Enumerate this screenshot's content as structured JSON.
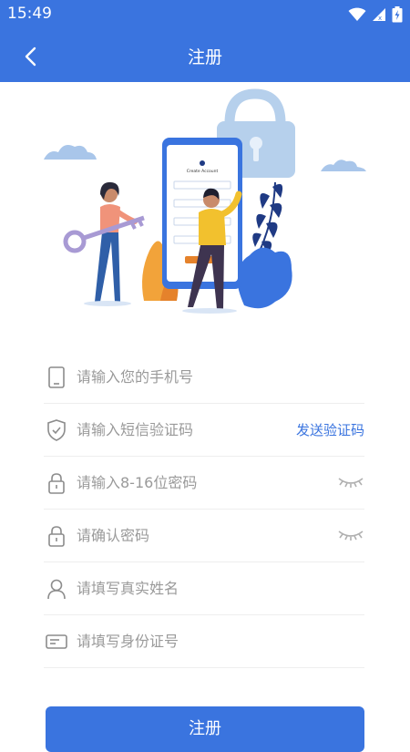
{
  "status_bar": {
    "time": "15:49",
    "icons": [
      "wifi-icon",
      "signal-icon",
      "battery-icon"
    ]
  },
  "header": {
    "title": "注册",
    "back_icon": "chevron-left-icon"
  },
  "illustration": {
    "phone_screen_title": "Create Account"
  },
  "form": {
    "phone": {
      "placeholder": "请输入您的手机号",
      "icon": "phone-icon"
    },
    "sms": {
      "placeholder": "请输入短信验证码",
      "icon": "shield-check-icon",
      "action_label": "发送验证码"
    },
    "password": {
      "placeholder": "请输入8-16位密码",
      "icon": "lock-icon",
      "toggle_icon": "eye-closed-icon"
    },
    "confirm": {
      "placeholder": "请确认密码",
      "icon": "lock-icon",
      "toggle_icon": "eye-closed-icon"
    },
    "name": {
      "placeholder": "请填写真实姓名",
      "icon": "user-icon"
    },
    "id_card": {
      "placeholder": "请填写身份证号",
      "icon": "id-card-icon"
    }
  },
  "submit": {
    "label": "注册"
  },
  "colors": {
    "primary": "#3a74df",
    "placeholder": "#9a9a9a",
    "divider": "#eeeeee"
  }
}
